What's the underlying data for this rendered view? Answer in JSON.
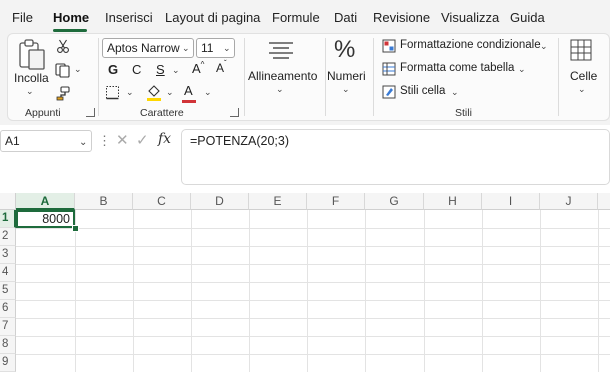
{
  "menu": {
    "items": [
      "File",
      "Home",
      "Inserisci",
      "Layout di pagina",
      "Formule",
      "Dati",
      "Revisione",
      "Visualizza",
      "Guida"
    ],
    "active": "Home"
  },
  "ribbon": {
    "clipboard": {
      "paste_label": "Incolla",
      "group_label": "Appunti"
    },
    "font": {
      "font_name": "Aptos Narrow",
      "font_size": "11",
      "bold": "G",
      "italic": "C",
      "underline": "S",
      "grow": "A",
      "shrink": "A",
      "font_color": "A",
      "group_label": "Carattere"
    },
    "alignment": {
      "label": "Allineamento"
    },
    "number": {
      "label": "Numeri",
      "symbol": "%"
    },
    "styles": {
      "conditional": "Formattazione condizionale",
      "table": "Formatta come tabella",
      "cell_styles": "Stili cella",
      "group_label": "Stili"
    },
    "cells": {
      "label": "Celle"
    }
  },
  "formula_bar": {
    "name_box": "A1",
    "fx": "fx",
    "formula": "=POTENZA(20;3)"
  },
  "sheet": {
    "columns": [
      "A",
      "B",
      "C",
      "D",
      "E",
      "F",
      "G",
      "H",
      "I",
      "J"
    ],
    "rows": [
      "1",
      "2",
      "3",
      "4",
      "5",
      "6",
      "7",
      "8",
      "9"
    ],
    "selected_cell": "A1",
    "cell_A1_value": "8000"
  },
  "colors": {
    "accent": "#1e6b3c",
    "font_color_bar": "#d13438",
    "fill_color_bar": "#ffd700"
  }
}
